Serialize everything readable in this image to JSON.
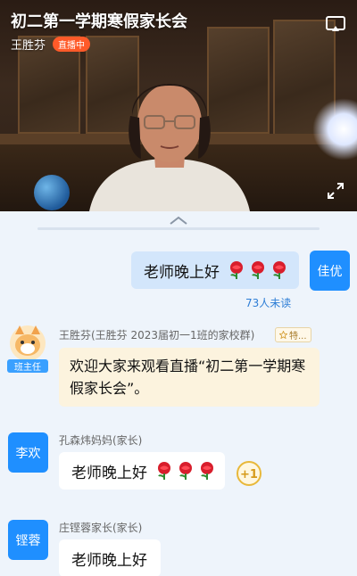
{
  "live": {
    "title": "初二第一学期寒假家长会",
    "host": "王胜芬",
    "status_badge": "直播中"
  },
  "messages": {
    "self": {
      "text": "老师晚上好",
      "avatar_label": "佳优",
      "emoji": "rose",
      "emoji_count": 3,
      "read_status": "73人未读"
    },
    "notice": {
      "sender": "王胜芬(王胜芬 2023届初一1班的家校群)",
      "group_tag": "特...",
      "role_badge": "班主任",
      "text": "欢迎大家来观看直播“初二第一学期寒假家长会”。"
    },
    "msg2": {
      "sender": "孔森炜妈妈(家长)",
      "avatar_label": "李欢",
      "text": "老师晚上好",
      "emoji": "rose",
      "emoji_count": 3
    },
    "msg3": {
      "sender": "庄铿蓉家长(家长)",
      "avatar_label": "铿蓉",
      "text": "老师晚上好"
    }
  },
  "colors": {
    "accent": "#1f8fff",
    "live_badge": "#ff5a29",
    "self_bubble": "#d3e6fb",
    "notice_bubble": "#fcf3de",
    "background": "#eef4fb"
  },
  "icons": [
    "pip-icon",
    "fullscreen-icon",
    "chevron-up-icon",
    "rose-icon",
    "plus-one-icon",
    "star-icon"
  ]
}
